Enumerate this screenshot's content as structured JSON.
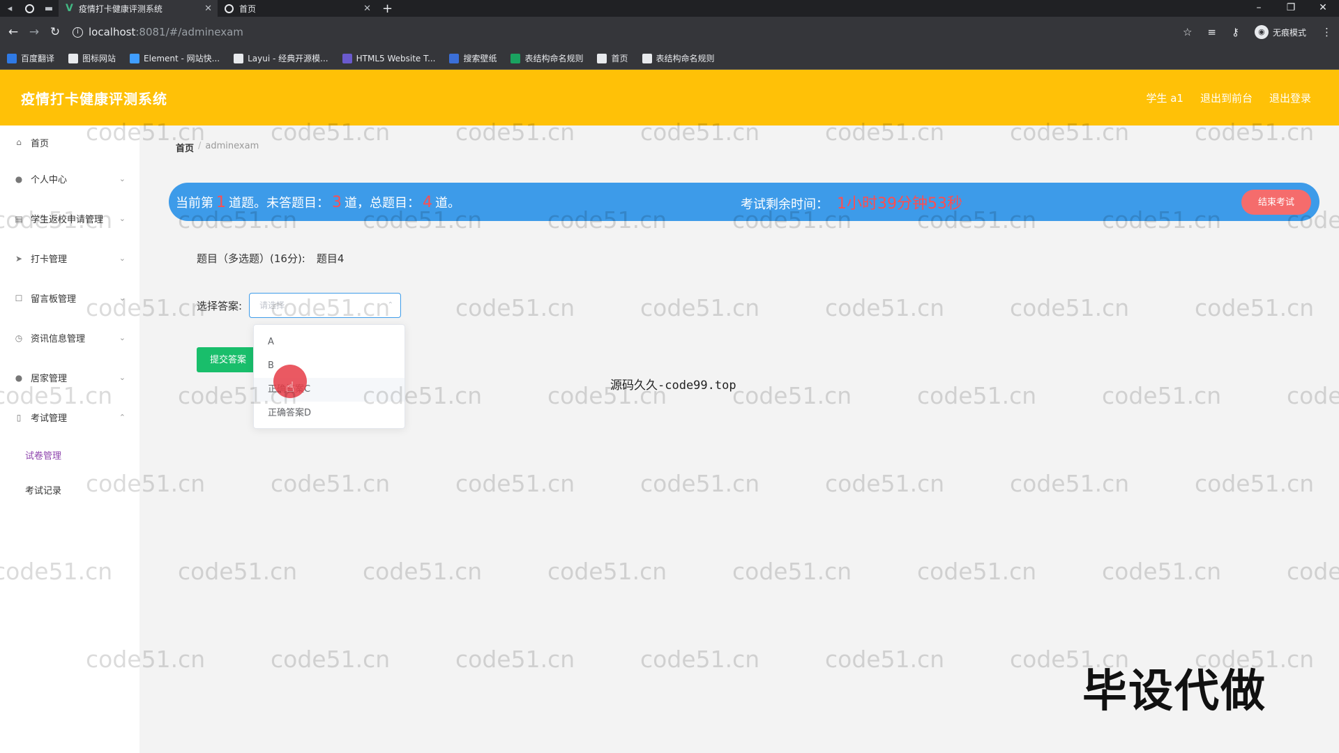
{
  "browser": {
    "tabs": [
      {
        "title": "疫情打卡健康评测系统",
        "active": true
      },
      {
        "title": "首页",
        "active": false
      }
    ],
    "url_host": "localhost",
    "url_path": ":8081/#/adminexam",
    "incognito_label": "无痕模式",
    "bookmarks": [
      {
        "label": "百度翻译",
        "color": "#2f7ae5"
      },
      {
        "label": "图标网站",
        "color": "#e8eaed"
      },
      {
        "label": "Element - 网站快...",
        "color": "#409eff"
      },
      {
        "label": "Layui - 经典开源模...",
        "color": "#e8eaed"
      },
      {
        "label": "HTML5 Website T...",
        "color": "#6a5acd"
      },
      {
        "label": "搜索壁纸",
        "color": "#3b6fd8"
      },
      {
        "label": "表结构命名规则",
        "color": "#1aa260"
      },
      {
        "label": "首页",
        "color": "#e8eaed"
      },
      {
        "label": "表结构命名规则",
        "color": "#e8eaed"
      }
    ]
  },
  "header": {
    "title": "疫情打卡健康评测系统",
    "user": "学生 a1",
    "back_front": "退出到前台",
    "logout": "退出登录"
  },
  "sidebar": {
    "items": [
      {
        "label": "首页",
        "icon": "home-icon",
        "glyph": "⌂",
        "arrow": ""
      },
      {
        "label": "个人中心",
        "icon": "user-icon",
        "glyph": "●",
        "arrow": "⌄"
      },
      {
        "label": "学生返校申请管理",
        "icon": "clipboard-icon",
        "glyph": "▤",
        "arrow": "⌄"
      },
      {
        "label": "打卡管理",
        "icon": "send-icon",
        "glyph": "➤",
        "arrow": "⌄"
      },
      {
        "label": "留言板管理",
        "icon": "square-icon",
        "glyph": "☐",
        "arrow": "⌄"
      },
      {
        "label": "资讯信息管理",
        "icon": "clock-icon",
        "glyph": "◷",
        "arrow": "⌄"
      },
      {
        "label": "居家管理",
        "icon": "person-icon",
        "glyph": "●",
        "arrow": "⌄"
      },
      {
        "label": "考试管理",
        "icon": "phone-icon",
        "glyph": "▯",
        "arrow": "⌃"
      }
    ],
    "sub_items": [
      {
        "label": "试卷管理",
        "active": true
      },
      {
        "label": "考试记录",
        "active": false
      }
    ]
  },
  "breadcrumb": {
    "home": "首页",
    "sep": "/",
    "current": "adminexam"
  },
  "exam_bar": {
    "prefix": "当前第",
    "current_no": "1",
    "mid1": "道题。未答题目：",
    "unanswered": "3",
    "mid2": "道，总题目：",
    "total": "4",
    "suffix": "道。",
    "time_label": "考试剩余时间：",
    "time_value": "1小时39分钟53秒",
    "end_button": "结束考试"
  },
  "question": {
    "meta": "题目（多选题）(16分):",
    "title": "题目4"
  },
  "answer": {
    "label": "选择答案:",
    "placeholder": "请选择",
    "options": [
      "A",
      "B",
      "正确答案C",
      "正确答案D"
    ],
    "hovered_index": 2
  },
  "submit_button": "提交答案",
  "overlay_text": "源码久久-code99.top",
  "big_watermark": "毕设代做",
  "watermark_text": "code51.cn",
  "colors": {
    "header": "#ffc107",
    "exam_bar": "#3d9be9",
    "red": "#ff4d4f",
    "submit": "#19be6b",
    "active_sub": "#8e44ad"
  }
}
